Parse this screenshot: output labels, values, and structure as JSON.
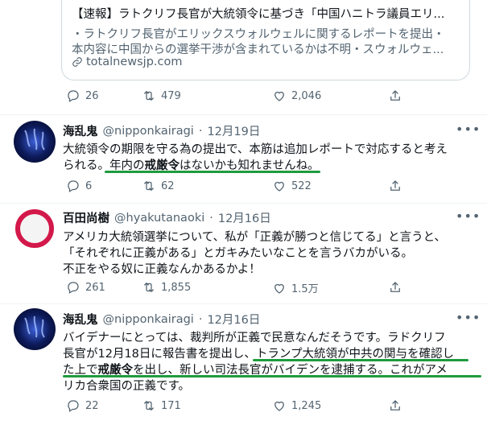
{
  "link_card": {
    "title": "【速報】ラトクリフ長官が大統領令に基づき「中国ハニトラ議員エリ...",
    "desc_line1": "・ラトクリフ長官がエリックスウォルウェルに関するレポートを提出・",
    "desc_line2": "本内容に中国からの選挙干渉が含まれているかは不明・スウォルウェ...",
    "domain": "totalnewsjp.com"
  },
  "card_actions": {
    "replies": "26",
    "retweets": "479",
    "likes": "2,046"
  },
  "tweets": [
    {
      "name": "海乱鬼",
      "handle": "@nipponkairagi",
      "date": "12月19日",
      "line1": "大統領令の期限を守る為の提出で、本筋は追加レポートで対応すると考え",
      "line2_a": "られる。",
      "line2_b": "年内の",
      "line2_c": "戒厳令",
      "line2_d": "はないかも知れませんね。",
      "replies": "6",
      "retweets": "62",
      "likes": "522"
    },
    {
      "name": "百田尚樹",
      "handle": "@hyakutanaoki",
      "date": "12月16日",
      "line1": "アメリカ大統領選挙について、私が「正義が勝つと信じてる」と言うと、",
      "line2": "「それぞれに正義がある」とガキみたいなことを言うバカがいる。",
      "line3": "不正をやる奴に正義なんかあるかよ！",
      "replies": "261",
      "retweets": "1,855",
      "likes": "1.5万"
    },
    {
      "name": "海乱鬼",
      "handle": "@nipponkairagi",
      "date": "12月16日",
      "line1": "バイデナーにとっては、裁判所が正義で民意なんだそうです。ラドクリフ",
      "line2_a": "長官が12月18日に報告書を提出し、",
      "line2_b": "トランプ大統領が中共の関与を確認し",
      "line3_a": "た上で",
      "line3_b": "戒厳令",
      "line3_c": "を出し、新しい司法長官がバイデンを逮捕する。これがアメ",
      "line4": "リカ合衆国の正義です。",
      "replies": "22",
      "retweets": "171",
      "likes": "1,245"
    }
  ],
  "more_glyph": "•••",
  "colors": {
    "underline": "#1f9b3e",
    "muted": "#536471"
  }
}
